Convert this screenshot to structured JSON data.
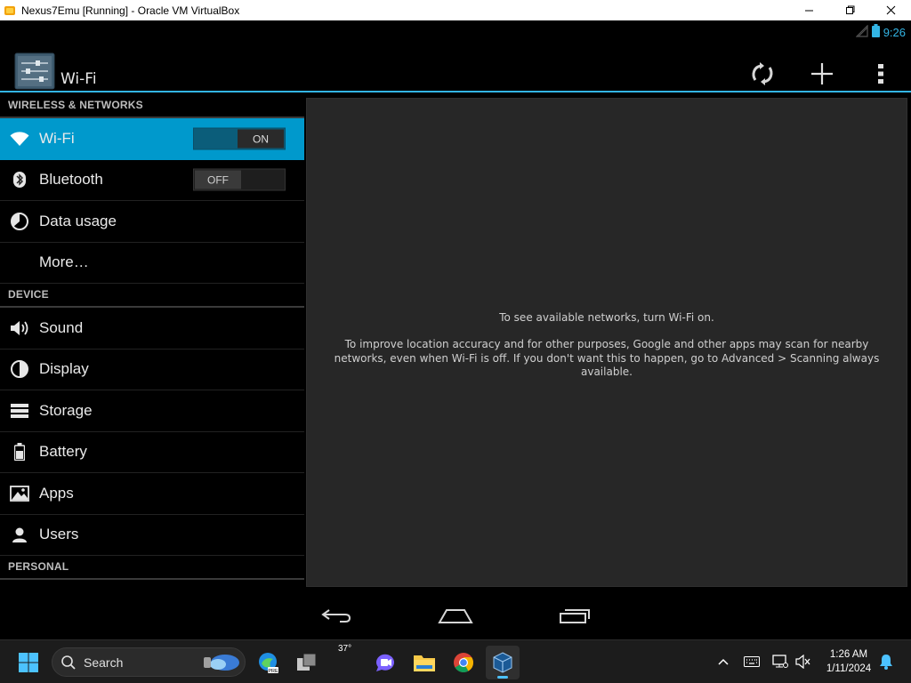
{
  "window": {
    "title": "Nexus7Emu [Running] - Oracle VM VirtualBox",
    "controls": [
      "minimize-icon",
      "maximize-icon",
      "close-icon"
    ]
  },
  "android": {
    "status_bar": {
      "time": "9:26",
      "icons": [
        "signal-icon",
        "battery-icon",
        "notification-icon"
      ]
    },
    "action_bar": {
      "title": "Wi-Fi",
      "actions": [
        "wps-icon",
        "add-network-icon",
        "overflow-menu-icon"
      ]
    },
    "settings": {
      "sections": [
        {
          "header": "WIRELESS & NETWORKS",
          "items": [
            {
              "label": "Wi-Fi",
              "icon": "wifi-icon",
              "selected": true,
              "toggle": "ON"
            },
            {
              "label": "Bluetooth",
              "icon": "bluetooth-icon",
              "toggle": "OFF"
            },
            {
              "label": "Data usage",
              "icon": "data-usage-icon"
            },
            {
              "label": "More…",
              "icon": ""
            }
          ]
        },
        {
          "header": "DEVICE",
          "items": [
            {
              "label": "Sound",
              "icon": "sound-icon"
            },
            {
              "label": "Display",
              "icon": "display-icon"
            },
            {
              "label": "Storage",
              "icon": "storage-icon"
            },
            {
              "label": "Battery",
              "icon": "battery-icon"
            },
            {
              "label": "Apps",
              "icon": "apps-icon"
            },
            {
              "label": "Users",
              "icon": "users-icon"
            }
          ]
        },
        {
          "header": "PERSONAL",
          "items": []
        }
      ]
    },
    "detail": {
      "message_primary": "To see available networks, turn Wi-Fi on.",
      "message_secondary": "To improve location accuracy and for other purposes, Google and other apps may scan for nearby networks, even when Wi-Fi is off. If you don't want this to happen, go to Advanced > Scanning always available."
    },
    "nav_bar": [
      "back-icon",
      "home-icon",
      "recents-icon"
    ]
  },
  "taskbar": {
    "search_label": "Search",
    "weather_temp": "37°",
    "clock_time": "1:26 AM",
    "clock_date": "1/11/2024",
    "colors": {
      "accent": "#4cc2ff",
      "android_accent": "#33b5e5",
      "selected": "#0099cc"
    }
  }
}
